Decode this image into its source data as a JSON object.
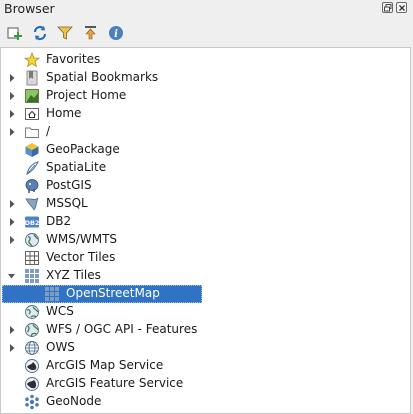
{
  "panel": {
    "title": "Browser"
  },
  "toolbar": {
    "buttons": [
      "add-selected-layers",
      "refresh",
      "filter",
      "collapse-all",
      "properties"
    ]
  },
  "tree": {
    "items": [
      {
        "label": "Favorites",
        "icon": "star-icon",
        "expandable": false,
        "expanded": false,
        "depth": 0
      },
      {
        "label": "Spatial Bookmarks",
        "icon": "bookmark-icon",
        "expandable": true,
        "expanded": false,
        "depth": 0
      },
      {
        "label": "Project Home",
        "icon": "project-home-icon",
        "expandable": true,
        "expanded": false,
        "depth": 0
      },
      {
        "label": "Home",
        "icon": "home-icon",
        "expandable": true,
        "expanded": false,
        "depth": 0
      },
      {
        "label": "/",
        "icon": "folder-icon",
        "expandable": true,
        "expanded": false,
        "depth": 0
      },
      {
        "label": "GeoPackage",
        "icon": "geopackage-icon",
        "expandable": false,
        "expanded": false,
        "depth": 0
      },
      {
        "label": "SpatiaLite",
        "icon": "spatialite-icon",
        "expandable": false,
        "expanded": false,
        "depth": 0
      },
      {
        "label": "PostGIS",
        "icon": "postgis-icon",
        "expandable": false,
        "expanded": false,
        "depth": 0
      },
      {
        "label": "MSSQL",
        "icon": "mssql-icon",
        "expandable": true,
        "expanded": false,
        "depth": 0
      },
      {
        "label": "DB2",
        "icon": "db2-icon",
        "expandable": true,
        "expanded": false,
        "depth": 0
      },
      {
        "label": "WMS/WMTS",
        "icon": "wms-globe-icon",
        "expandable": true,
        "expanded": false,
        "depth": 0
      },
      {
        "label": "Vector Tiles",
        "icon": "vector-tiles-icon",
        "expandable": false,
        "expanded": false,
        "depth": 0
      },
      {
        "label": "XYZ Tiles",
        "icon": "xyz-tiles-icon",
        "expandable": true,
        "expanded": true,
        "depth": 0
      },
      {
        "label": "OpenStreetMap",
        "icon": "tile-grid-icon",
        "expandable": false,
        "expanded": false,
        "depth": 1,
        "selected": true
      },
      {
        "label": "WCS",
        "icon": "wcs-globe-icon",
        "expandable": false,
        "expanded": false,
        "depth": 0
      },
      {
        "label": "WFS / OGC API - Features",
        "icon": "wfs-globe-icon",
        "expandable": true,
        "expanded": false,
        "depth": 0
      },
      {
        "label": "OWS",
        "icon": "ows-globe-icon",
        "expandable": true,
        "expanded": false,
        "depth": 0
      },
      {
        "label": "ArcGIS Map Service",
        "icon": "arcgis-map-icon",
        "expandable": false,
        "expanded": false,
        "depth": 0
      },
      {
        "label": "ArcGIS Feature Service",
        "icon": "arcgis-feature-icon",
        "expandable": false,
        "expanded": false,
        "depth": 0
      },
      {
        "label": "GeoNode",
        "icon": "geonode-icon",
        "expandable": false,
        "expanded": false,
        "depth": 0
      }
    ]
  },
  "colors": {
    "selection": "#3072c4",
    "background": "#efefef",
    "panel": "#ffffff"
  }
}
